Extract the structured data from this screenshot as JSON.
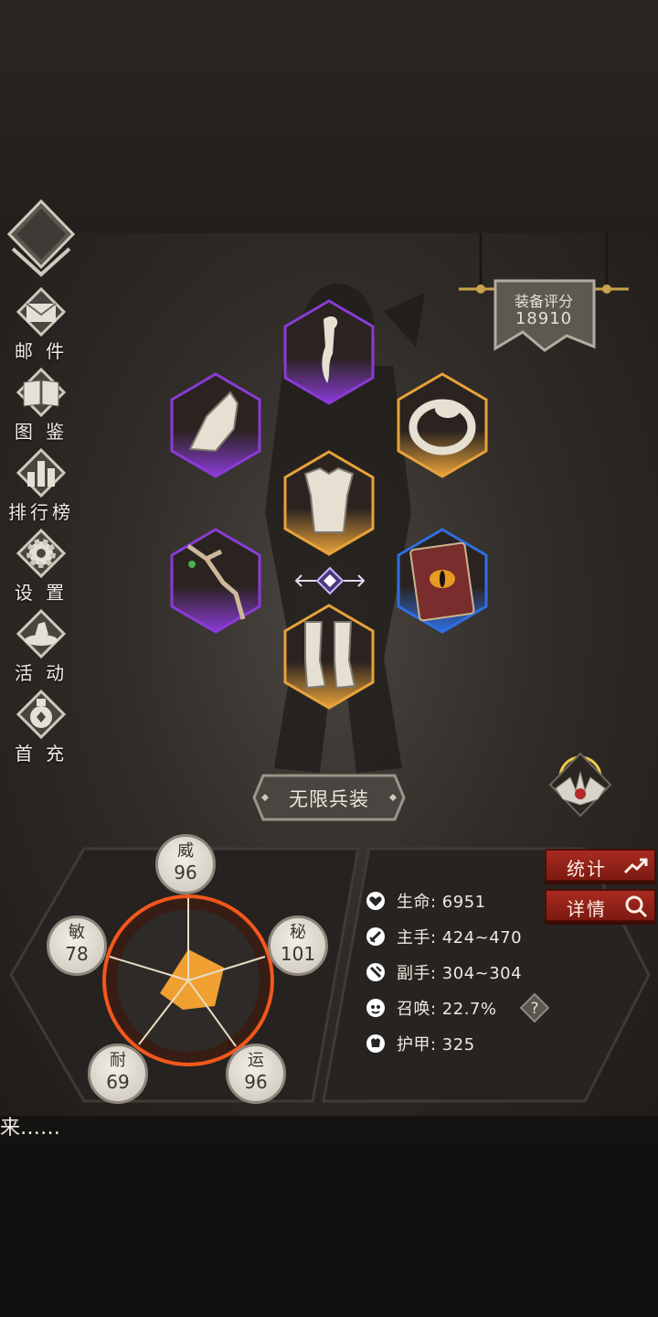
{
  "menu": {
    "items": [
      {
        "label": "邮 件",
        "icon": "mail-icon"
      },
      {
        "label": "图 鉴",
        "icon": "book-icon"
      },
      {
        "label": "排行榜",
        "icon": "ranking-icon"
      },
      {
        "label": "设 置",
        "icon": "gear-icon"
      },
      {
        "label": "活 动",
        "icon": "event-icon"
      },
      {
        "label": "首 充",
        "icon": "first-recharge-icon"
      }
    ]
  },
  "score": {
    "label": "装备评分",
    "value": "18910"
  },
  "equipment": {
    "slots": [
      {
        "name": "scarf",
        "rarity": "purple"
      },
      {
        "name": "gauntlet",
        "rarity": "purple"
      },
      {
        "name": "ring",
        "rarity": "orange"
      },
      {
        "name": "armor",
        "rarity": "orange"
      },
      {
        "name": "branch-staff",
        "rarity": "purple"
      },
      {
        "name": "eye-tome",
        "rarity": "blue"
      },
      {
        "name": "greaves",
        "rarity": "orange"
      }
    ],
    "set_title": "无限兵装"
  },
  "colors": {
    "purple": "#8a3bd6",
    "orange": "#e8a23a",
    "blue": "#2f6fe0",
    "red_button": "#a82a1f"
  },
  "attributes": {
    "wei": {
      "name": "威",
      "value": "96"
    },
    "mi": {
      "name": "秘",
      "value": "101"
    },
    "min": {
      "name": "敏",
      "value": "78"
    },
    "nai": {
      "name": "耐",
      "value": "69"
    },
    "yun": {
      "name": "运",
      "value": "96"
    }
  },
  "stats": [
    {
      "icon": "heart-icon",
      "text": "生命: 6951"
    },
    {
      "icon": "sword-icon",
      "text": "主手: 424~470"
    },
    {
      "icon": "offhand-icon",
      "text": "副手: 304~304"
    },
    {
      "icon": "summon-icon",
      "text": "召唤: 22.7%"
    },
    {
      "icon": "armor-icon",
      "text": "护甲: 325"
    }
  ],
  "buttons": {
    "stats": "统计",
    "details": "详情",
    "help": "?"
  },
  "marquee": "来……"
}
